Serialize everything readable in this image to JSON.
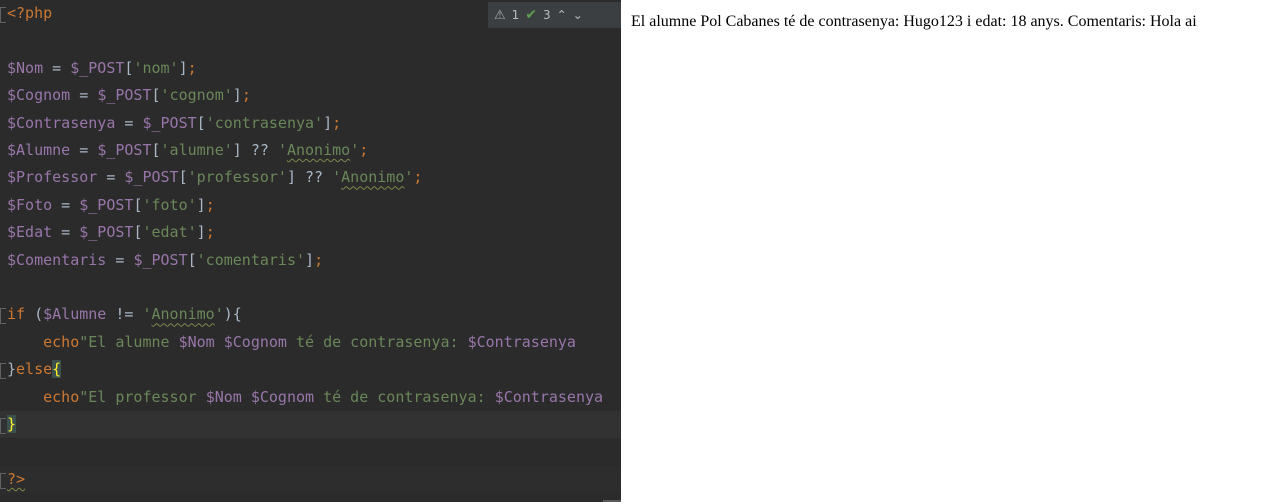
{
  "editor": {
    "inspections": {
      "warnings": "1",
      "typos": "3"
    },
    "lines": {
      "l1": "<?php",
      "l3_var": "$Nom",
      "l3_eq": " = ",
      "l3_post": "$_POST",
      "l3_b1": "[",
      "l3_key": "'nom'",
      "l3_b2": "]",
      "l3_semi": ";",
      "l4_var": "$Cognom",
      "l4_key": "'cognom'",
      "l5_var": "$Contrasenya",
      "l5_key": "'contrasenya'",
      "l6_var": "$Alumne",
      "l6_key": "'alumne'",
      "l6_coalesce": " ?? ",
      "l6_default": "Anonimo",
      "l7_var": "$Professor",
      "l7_key": "'professor'",
      "l7_default": "Anonimo",
      "l8_var": "$Foto",
      "l8_key": "'foto'",
      "l9_var": "$Edat",
      "l9_key": "'edat'",
      "l10_var": "$Comentaris",
      "l10_key": "'comentaris'",
      "l12_if": "if",
      "l12_open": " (",
      "l12_var": "$Alumne",
      "l12_neq": " != ",
      "l12_str": "Anonimo",
      "l12_close": "){",
      "l13_echo": "echo",
      "l13_str_a": "\"El alumne ",
      "l13_v1": "$Nom",
      "l13_v2": "$Cognom",
      "l13_mid": " té de contrasenya: ",
      "l13_v3": "$Contrasenya",
      "l14_close": "}",
      "l14_else": "else",
      "l14_open": "{",
      "l15_echo": "echo",
      "l15_str_a": "\"El professor ",
      "l15_v1": "$Nom",
      "l15_v2": "$Cognom",
      "l15_mid": " té de contrasenya: ",
      "l15_v3": "$Contrasenya",
      "l16_close": "}",
      "l18": "?>"
    }
  },
  "output": {
    "text": "El alumne Pol Cabanes té de contrasenya: Hugo123 i edat: 18 anys. Comentaris: Hola ai"
  },
  "colors": {
    "editor_bg": "#2b2b2b",
    "keyword": "#cc7832",
    "variable": "#9876aa",
    "string": "#6a8759",
    "plain": "#a9b7c6"
  },
  "icons": [
    "warning-icon",
    "typo-check-icon",
    "chevron-up-icon",
    "chevron-down-icon"
  ]
}
